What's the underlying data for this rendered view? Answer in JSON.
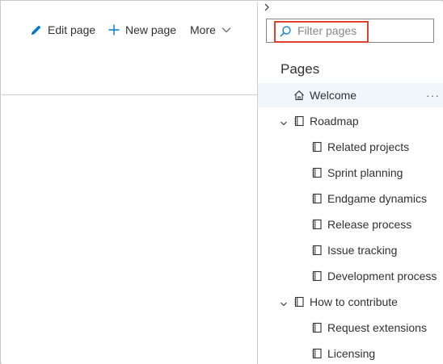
{
  "toolbar": {
    "edit_label": "Edit page",
    "new_label": "New page",
    "more_label": "More"
  },
  "sidebar": {
    "filter_placeholder": "Filter pages",
    "heading": "Pages",
    "more_actions": "···",
    "items": [
      {
        "label": "Welcome",
        "icon": "home-icon",
        "level": 0,
        "selected": true
      },
      {
        "label": "Roadmap",
        "icon": "page-icon",
        "level": 0,
        "expanded": true
      },
      {
        "label": "Related projects",
        "icon": "page-icon",
        "level": 1
      },
      {
        "label": "Sprint planning",
        "icon": "page-icon",
        "level": 1
      },
      {
        "label": "Endgame dynamics",
        "icon": "page-icon",
        "level": 1
      },
      {
        "label": "Release process",
        "icon": "page-icon",
        "level": 1
      },
      {
        "label": "Issue tracking",
        "icon": "page-icon",
        "level": 1
      },
      {
        "label": "Development process",
        "icon": "page-icon",
        "level": 1
      },
      {
        "label": "How to contribute",
        "icon": "page-icon",
        "level": 0,
        "expanded": true
      },
      {
        "label": "Request extensions",
        "icon": "page-icon",
        "level": 1
      },
      {
        "label": "Licensing",
        "icon": "page-icon",
        "level": 1
      }
    ]
  },
  "colors": {
    "accent": "#0078d4",
    "highlight_box": "#e0412e",
    "selected_row": "#eff6fc"
  }
}
